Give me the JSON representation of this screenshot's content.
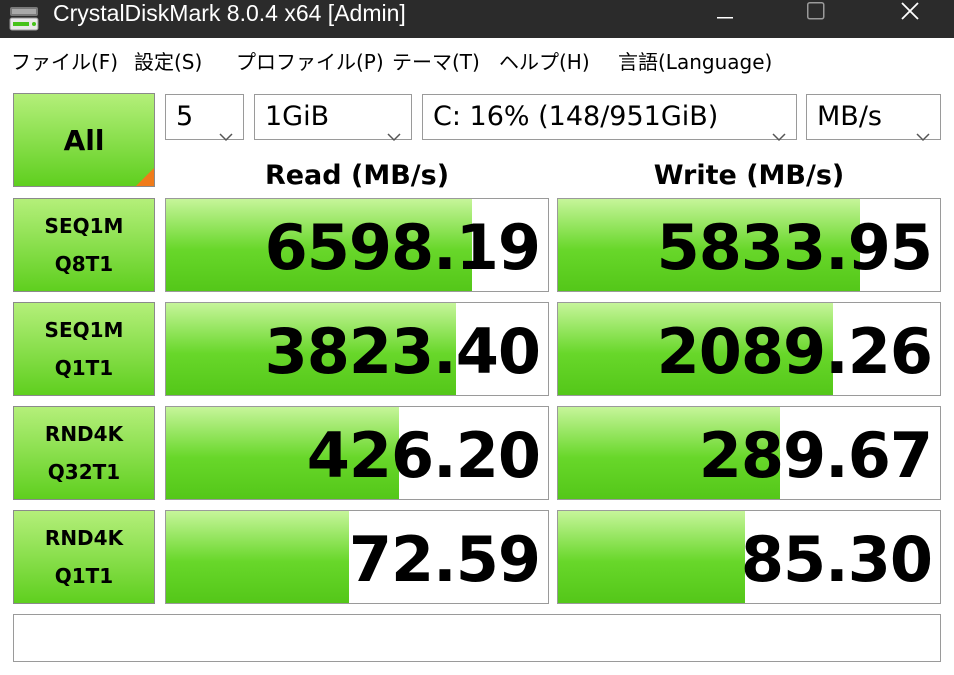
{
  "window": {
    "title": "CrystalDiskMark 8.0.4 x64 [Admin]"
  },
  "menu": [
    "ファイル(F)",
    "設定(S)",
    "プロファイル(P)",
    "テーマ(T)",
    "ヘルプ(H)",
    "言語(Language)"
  ],
  "controls": {
    "all_label": "All",
    "count": "5",
    "size": "1GiB",
    "drive": "C: 16% (148/951GiB)",
    "unit": "MB/s"
  },
  "headers": {
    "read": "Read (MB/s)",
    "write": "Write (MB/s)"
  },
  "tests": [
    {
      "line1": "SEQ1M",
      "line2": "Q8T1",
      "read": "6598.19",
      "write": "5833.95",
      "read_fill": 0.8,
      "write_fill": 0.79
    },
    {
      "line1": "SEQ1M",
      "line2": "Q1T1",
      "read": "3823.40",
      "write": "2089.26",
      "read_fill": 0.76,
      "write_fill": 0.72
    },
    {
      "line1": "RND4K",
      "line2": "Q32T1",
      "read": "426.20",
      "write": "289.67",
      "read_fill": 0.61,
      "write_fill": 0.58
    },
    {
      "line1": "RND4K",
      "line2": "Q1T1",
      "read": "72.59",
      "write": "85.30",
      "read_fill": 0.48,
      "write_fill": 0.49
    }
  ],
  "comment": "",
  "colors": {
    "titlebar": "#2b2b2b",
    "bar_green": "#68d72a",
    "corner_orange": "#f07b1a"
  },
  "icons": [
    "app-disk-icon",
    "minimize-icon",
    "maximize-icon",
    "close-icon",
    "chevron-down-icon"
  ]
}
